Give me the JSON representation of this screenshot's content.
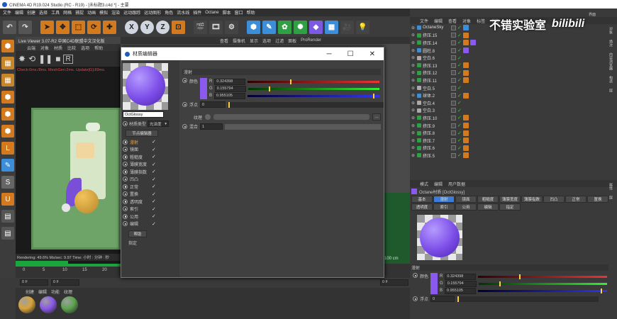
{
  "app": {
    "title": "CINEMA 4D R19.024 Studio (RC - R19) - [未标题3.c4d *] - 主要"
  },
  "menu": [
    "文件",
    "编辑",
    "创建",
    "选择",
    "工具",
    "网格",
    "捕捉",
    "动画",
    "模拟",
    "渲染",
    "运动跟踪",
    "运动图形",
    "角色",
    "流水线",
    "插件",
    "Octane",
    "脚本",
    "窗口",
    "帮助"
  ],
  "toolbar": {
    "axes": [
      "X",
      "Y",
      "Z"
    ]
  },
  "watermark": {
    "text": "不错实验室",
    "logo": "bilibili"
  },
  "live_viewer": {
    "title": "Live Viewer 3.07-R2 中国C4D联盟中文汉化版",
    "menu": [
      "云端",
      "对象",
      "材质",
      "比较",
      "选项",
      "帮助"
    ],
    "status": "Check:0ms./8ms. MeshGen:2ms. Update[G]:89ms.",
    "footer": "Rendering: 49.6%   Ms/sec: 9.97   Time: 小时 : 分钟 : 秒",
    "sidebar_icons": [
      "cube-icon",
      "checker-icon",
      "checker-icon",
      "cube-icon",
      "cube-icon",
      "cube-icon",
      "l-bracket-icon",
      "pen-icon",
      "s-icon",
      "magnet-icon",
      "grid-icon",
      "grid-icon"
    ]
  },
  "viewport_menu": [
    "查看",
    "摄像机",
    "显示",
    "选项",
    "过滤",
    "面板",
    "ProRender"
  ],
  "viewport_scale": "100 cm",
  "timeline": {
    "ticks": [
      "0",
      "5",
      "10",
      "15",
      "20",
      "2"
    ],
    "frame_left": "0 F",
    "frame_left2": "0 F",
    "frame_right": "0 F"
  },
  "material_manager": {
    "menu": [
      "创建",
      "编辑",
      "功能",
      "纹理"
    ],
    "materials": [
      {
        "color": "#d9a33a"
      },
      {
        "color": "#8a5ae6"
      },
      {
        "color": "#5da44f"
      }
    ]
  },
  "material_editor": {
    "title": "材质编辑器",
    "material_name": "OctGlossy",
    "material_type_label": "材质类型",
    "material_type_value": "光泽度",
    "node_editor": "节点编辑器",
    "channels": [
      {
        "name": "漫射",
        "active": true
      },
      {
        "name": "镜面",
        "active": false
      },
      {
        "name": "粗糙度",
        "active": false
      },
      {
        "name": "薄膜宽度",
        "active": false
      },
      {
        "name": "薄膜指数",
        "active": false
      },
      {
        "name": "凹凸",
        "active": false
      },
      {
        "name": "正常",
        "active": false
      },
      {
        "name": "置换",
        "active": false
      },
      {
        "name": "透明度",
        "active": false
      },
      {
        "name": "索引",
        "active": false
      },
      {
        "name": "公用",
        "active": false
      },
      {
        "name": "编辑",
        "active": false
      }
    ],
    "help": "帮助",
    "assign": "指定",
    "section": "漫射",
    "color_label": "颜色",
    "color_hex": "#8a5aef",
    "r": {
      "label": "R",
      "value": "0.324398"
    },
    "g": {
      "label": "G",
      "value": "0.155794"
    },
    "b": {
      "label": "B",
      "value": "0.955105"
    },
    "float_label": "浮点",
    "float_value": "0",
    "texture_label": "纹理",
    "mix_label": "混合",
    "mix_value": "1"
  },
  "object_manager": {
    "menu": [
      "文件",
      "编辑",
      "查看",
      "对象",
      "标签",
      "书签"
    ],
    "objects": [
      {
        "name": "OctaneSky",
        "icon": "sky",
        "tags": [
          "sky"
        ]
      },
      {
        "name": "挤压.15",
        "icon": "extrude",
        "tags": [
          "mat"
        ]
      },
      {
        "name": "挤压.14",
        "icon": "extrude",
        "tags": [
          "mat",
          "purple"
        ]
      },
      {
        "name": "圆柱.8",
        "icon": "cylinder",
        "tags": [
          "purple"
        ]
      },
      {
        "name": "空白.6",
        "icon": "null",
        "tags": []
      },
      {
        "name": "挤压.13",
        "icon": "extrude",
        "tags": [
          "mat"
        ]
      },
      {
        "name": "挤压.12",
        "icon": "extrude",
        "tags": [
          "mat"
        ]
      },
      {
        "name": "挤压.11",
        "icon": "extrude",
        "tags": [
          "mat"
        ]
      },
      {
        "name": "空白.5",
        "icon": "null",
        "tags": []
      },
      {
        "name": "球体.2",
        "icon": "sphere",
        "tags": [
          "mat"
        ]
      },
      {
        "name": "空白.4",
        "icon": "null",
        "tags": []
      },
      {
        "name": "空白.3",
        "icon": "null",
        "tags": []
      },
      {
        "name": "挤压.10",
        "icon": "extrude",
        "tags": [
          "mat"
        ]
      },
      {
        "name": "挤压.9",
        "icon": "extrude",
        "tags": [
          "mat"
        ]
      },
      {
        "name": "挤压.8",
        "icon": "extrude",
        "tags": [
          "mat"
        ]
      },
      {
        "name": "挤压.7",
        "icon": "extrude",
        "tags": [
          "mat"
        ]
      },
      {
        "name": "挤压.6",
        "icon": "extrude",
        "tags": [
          "mat"
        ]
      },
      {
        "name": "挤压.5",
        "icon": "extrude",
        "tags": [
          "mat"
        ]
      }
    ],
    "side_tabs": [
      "对象",
      "场次",
      "内容浏览器",
      "构造",
      "层"
    ]
  },
  "attribute_manager": {
    "menu": [
      "模式",
      "编辑",
      "用户数据"
    ],
    "title": "Octane材质 [OctGlossy]",
    "tabs_row1": [
      "基本",
      "漫射",
      "镜面",
      "粗糙度",
      "薄膜宽度",
      "薄膜指数",
      "凹凸",
      "正常",
      "置换"
    ],
    "tabs_row2": [
      "透明度",
      "索引",
      "公用",
      "编辑",
      "指定"
    ],
    "active_tab": "漫射",
    "section": "漫射",
    "color_label": "颜色",
    "r": {
      "label": "R",
      "value": "0.324398"
    },
    "g": {
      "label": "G",
      "value": "0.155794"
    },
    "b": {
      "label": "B",
      "value": "0.955105"
    },
    "float_label": "浮点",
    "float_value": "0",
    "side_tabs": [
      "属性",
      "层"
    ]
  },
  "top_right": {
    "layout": "界面",
    "startup": "启动"
  }
}
